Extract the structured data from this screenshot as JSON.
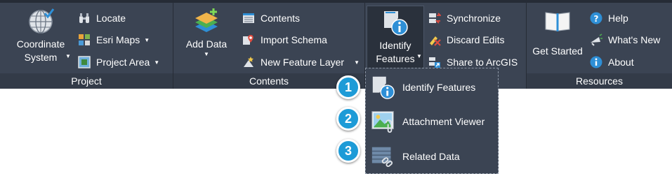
{
  "ribbon": {
    "project": {
      "footer": "Project",
      "coordinate_system_line1": "Coordinate",
      "coordinate_system_line2": "System",
      "locate": "Locate",
      "esri_maps": "Esri Maps",
      "project_area": "Project  Area"
    },
    "contents": {
      "footer": "Contents",
      "add_data": "Add Data",
      "contents": "Contents",
      "import_schema": "Import Schema",
      "new_feature_layer": "New Feature Layer"
    },
    "edit": {
      "identify_line1": "Identify",
      "identify_line2": "Features",
      "synchronize": "Synchronize",
      "discard_edits": "Discard Edits",
      "share_to_arcgis": "Share to ArcGIS"
    },
    "resources": {
      "footer": "Resources",
      "get_started": "Get Started",
      "help": "Help",
      "whats_new": "What's New",
      "about": "About"
    }
  },
  "dropdown": {
    "items": [
      {
        "number": "1",
        "label": "Identify Features"
      },
      {
        "number": "2",
        "label": "Attachment Viewer"
      },
      {
        "number": "3",
        "label": "Related Data"
      }
    ]
  },
  "colors": {
    "ribbon_bg": "#3b4453",
    "footer_bg": "#333b48",
    "badge": "#1d9bd7",
    "accent_blue": "#2e8fd6"
  }
}
